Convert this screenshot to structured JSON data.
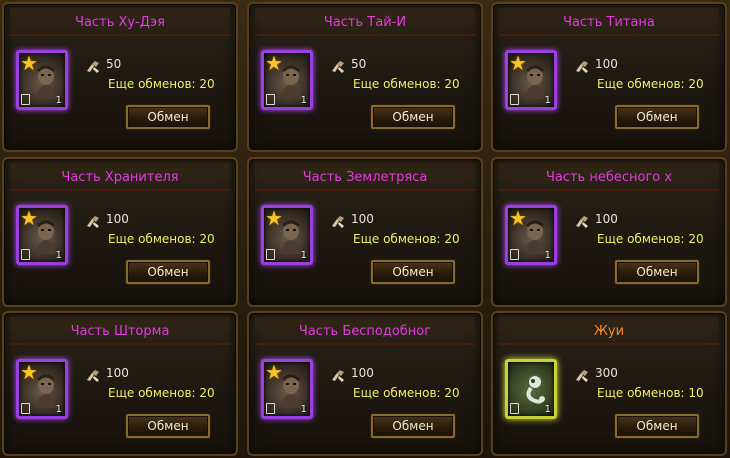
{
  "cards": [
    {
      "title": "Часть Ху-Дэя",
      "cost": "50",
      "remaining": "Еще обменов: 20",
      "count": "1",
      "button": "Обмен",
      "star": true,
      "frame": "purple",
      "title_color": "magenta",
      "portrait": "warrior-portrait-icon"
    },
    {
      "title": "Часть Тай-И",
      "cost": "50",
      "remaining": "Еще обменов: 20",
      "count": "1",
      "button": "Обмен",
      "star": true,
      "frame": "purple",
      "title_color": "magenta",
      "portrait": "sage-portrait-icon"
    },
    {
      "title": "Часть Титана",
      "cost": "100",
      "remaining": "Еще обменов: 20",
      "count": "1",
      "button": "Обмен",
      "star": true,
      "frame": "purple",
      "title_color": "magenta",
      "portrait": "titan-portrait-icon"
    },
    {
      "title": "Часть Хранителя",
      "cost": "100",
      "remaining": "Еще обменов: 20",
      "count": "1",
      "button": "Обмен",
      "star": true,
      "frame": "purple",
      "title_color": "magenta",
      "portrait": "guardian-portrait-icon"
    },
    {
      "title": "Часть Землетряса",
      "cost": "100",
      "remaining": "Еще обменов: 20",
      "count": "1",
      "button": "Обмен",
      "star": true,
      "frame": "purple",
      "title_color": "magenta",
      "portrait": "earthquake-portrait-icon"
    },
    {
      "title": "Часть небесного х",
      "cost": "100",
      "remaining": "Еще обменов: 20",
      "count": "1",
      "button": "Обмен",
      "star": true,
      "frame": "purple",
      "title_color": "magenta",
      "portrait": "celestial-portrait-icon"
    },
    {
      "title": "Часть Шторма",
      "cost": "100",
      "remaining": "Еще обменов: 20",
      "count": "1",
      "button": "Обмен",
      "star": true,
      "frame": "purple",
      "title_color": "magenta",
      "portrait": "storm-portrait-icon"
    },
    {
      "title": "Часть Бесподобног",
      "cost": "100",
      "remaining": "Еще обменов: 20",
      "count": "1",
      "button": "Обмен",
      "star": true,
      "frame": "purple",
      "title_color": "magenta",
      "portrait": "peerless-portrait-icon"
    },
    {
      "title": "Жуи",
      "cost": "300",
      "remaining": "Еще обменов: 10",
      "count": "1",
      "button": "Обмен",
      "star": false,
      "frame": "yellow",
      "title_color": "orange",
      "portrait": "ruyi-scepter-icon"
    }
  ],
  "colors": {
    "title_magenta": "#e23ddf",
    "title_orange": "#ff8a2a",
    "remaining_text": "#f3ee6a",
    "frame_purple": "#9b3fe0",
    "frame_yellow": "#c8d33a"
  },
  "resource_icon": "exchange-material-icon"
}
